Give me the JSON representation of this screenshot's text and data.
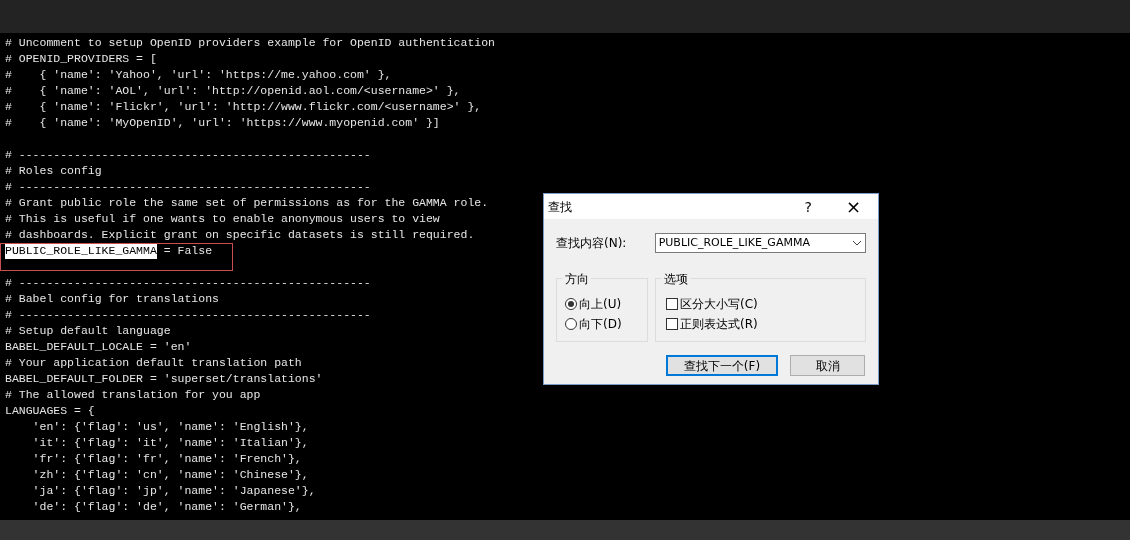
{
  "editor": {
    "lines": [
      {
        "text": "# Uncomment to setup OpenID providers example for OpenID authentication"
      },
      {
        "text": "# OPENID_PROVIDERS = ["
      },
      {
        "text": "#    { 'name': 'Yahoo', 'url': 'https://me.yahoo.com' },"
      },
      {
        "text": "#    { 'name': 'AOL', 'url': 'http://openid.aol.com/<username>' },"
      },
      {
        "text": "#    { 'name': 'Flickr', 'url': 'http://www.flickr.com/<username>' },"
      },
      {
        "text": "#    { 'name': 'MyOpenID', 'url': 'https://www.myopenid.com' }]"
      },
      {
        "kind": "blank"
      },
      {
        "text": "# ---------------------------------------------------"
      },
      {
        "text": "# Roles config"
      },
      {
        "text": "# ---------------------------------------------------"
      },
      {
        "text": "# Grant public role the same set of permissions as for the GAMMA role."
      },
      {
        "text": "# This is useful if one wants to enable anonymous users to view"
      },
      {
        "text": "# dashboards. Explicit grant on specific datasets is still required."
      },
      {
        "annotated": true,
        "parts": [
          {
            "text": "PUBLIC_ROLE_LIKE_GAMMA",
            "selected": true
          },
          {
            "text": " = False",
            "selected": false
          }
        ]
      },
      {
        "kind": "blank"
      },
      {
        "text": "# ---------------------------------------------------"
      },
      {
        "text": "# Babel config for translations"
      },
      {
        "text": "# ---------------------------------------------------"
      },
      {
        "text": "# Setup default language"
      },
      {
        "text": "BABEL_DEFAULT_LOCALE = 'en'"
      },
      {
        "text": "# Your application default translation path"
      },
      {
        "text": "BABEL_DEFAULT_FOLDER = 'superset/translations'"
      },
      {
        "text": "# The allowed translation for you app"
      },
      {
        "text": "LANGUAGES = {"
      },
      {
        "text": "    'en': {'flag': 'us', 'name': 'English'},"
      },
      {
        "text": "    'it': {'flag': 'it', 'name': 'Italian'},"
      },
      {
        "text": "    'fr': {'flag': 'fr', 'name': 'French'},"
      },
      {
        "text": "    'zh': {'flag': 'cn', 'name': 'Chinese'},"
      },
      {
        "text": "    'ja': {'flag': 'jp', 'name': 'Japanese'},"
      },
      {
        "text": "    'de': {'flag': 'de', 'name': 'German'},"
      }
    ]
  },
  "find_dialog": {
    "title": "查找",
    "help": "?",
    "close": "×",
    "find_label": "查找内容(N):",
    "find_value": "PUBLIC_ROLE_LIKE_GAMMA",
    "direction": {
      "title": "方向",
      "options": [
        {
          "label": "向上(U)",
          "selected": true
        },
        {
          "label": "向下(D)",
          "selected": false
        }
      ]
    },
    "options": {
      "title": "选项",
      "items": [
        {
          "label": "区分大小写(C)",
          "checked": false
        },
        {
          "label": "正则表达式(R)",
          "checked": false
        }
      ]
    },
    "buttons": [
      {
        "label": "查找下一个(F)",
        "default": true
      },
      {
        "label": "取消",
        "default": false
      }
    ]
  }
}
